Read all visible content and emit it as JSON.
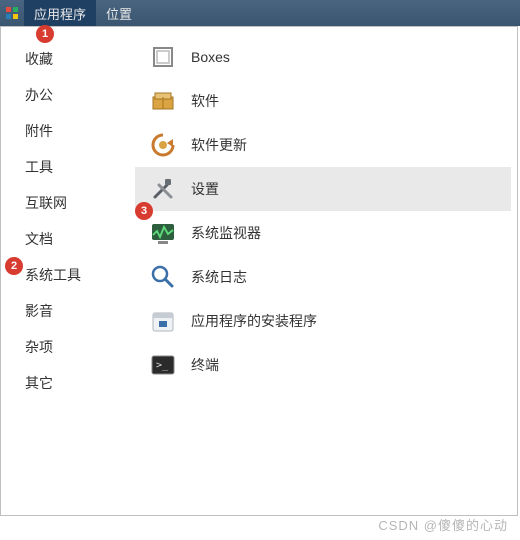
{
  "menubar": {
    "applications": "应用程序",
    "places": "位置"
  },
  "categories": [
    {
      "label": "收藏"
    },
    {
      "label": "办公"
    },
    {
      "label": "附件"
    },
    {
      "label": "工具"
    },
    {
      "label": "互联网"
    },
    {
      "label": "文档"
    },
    {
      "label": "系统工具"
    },
    {
      "label": "影音"
    },
    {
      "label": "杂项"
    },
    {
      "label": "其它"
    }
  ],
  "apps": [
    {
      "label": "Boxes",
      "icon": "boxes"
    },
    {
      "label": "软件",
      "icon": "software"
    },
    {
      "label": "软件更新",
      "icon": "software-update"
    },
    {
      "label": "设置",
      "icon": "settings",
      "selected": true
    },
    {
      "label": "系统监视器",
      "icon": "system-monitor"
    },
    {
      "label": "系统日志",
      "icon": "system-log"
    },
    {
      "label": "应用程序的安装程序",
      "icon": "installer"
    },
    {
      "label": "终端",
      "icon": "terminal"
    }
  ],
  "badges": {
    "b1": "1",
    "b2": "2",
    "b3": "3"
  },
  "watermark": "CSDN @傻傻的心动"
}
